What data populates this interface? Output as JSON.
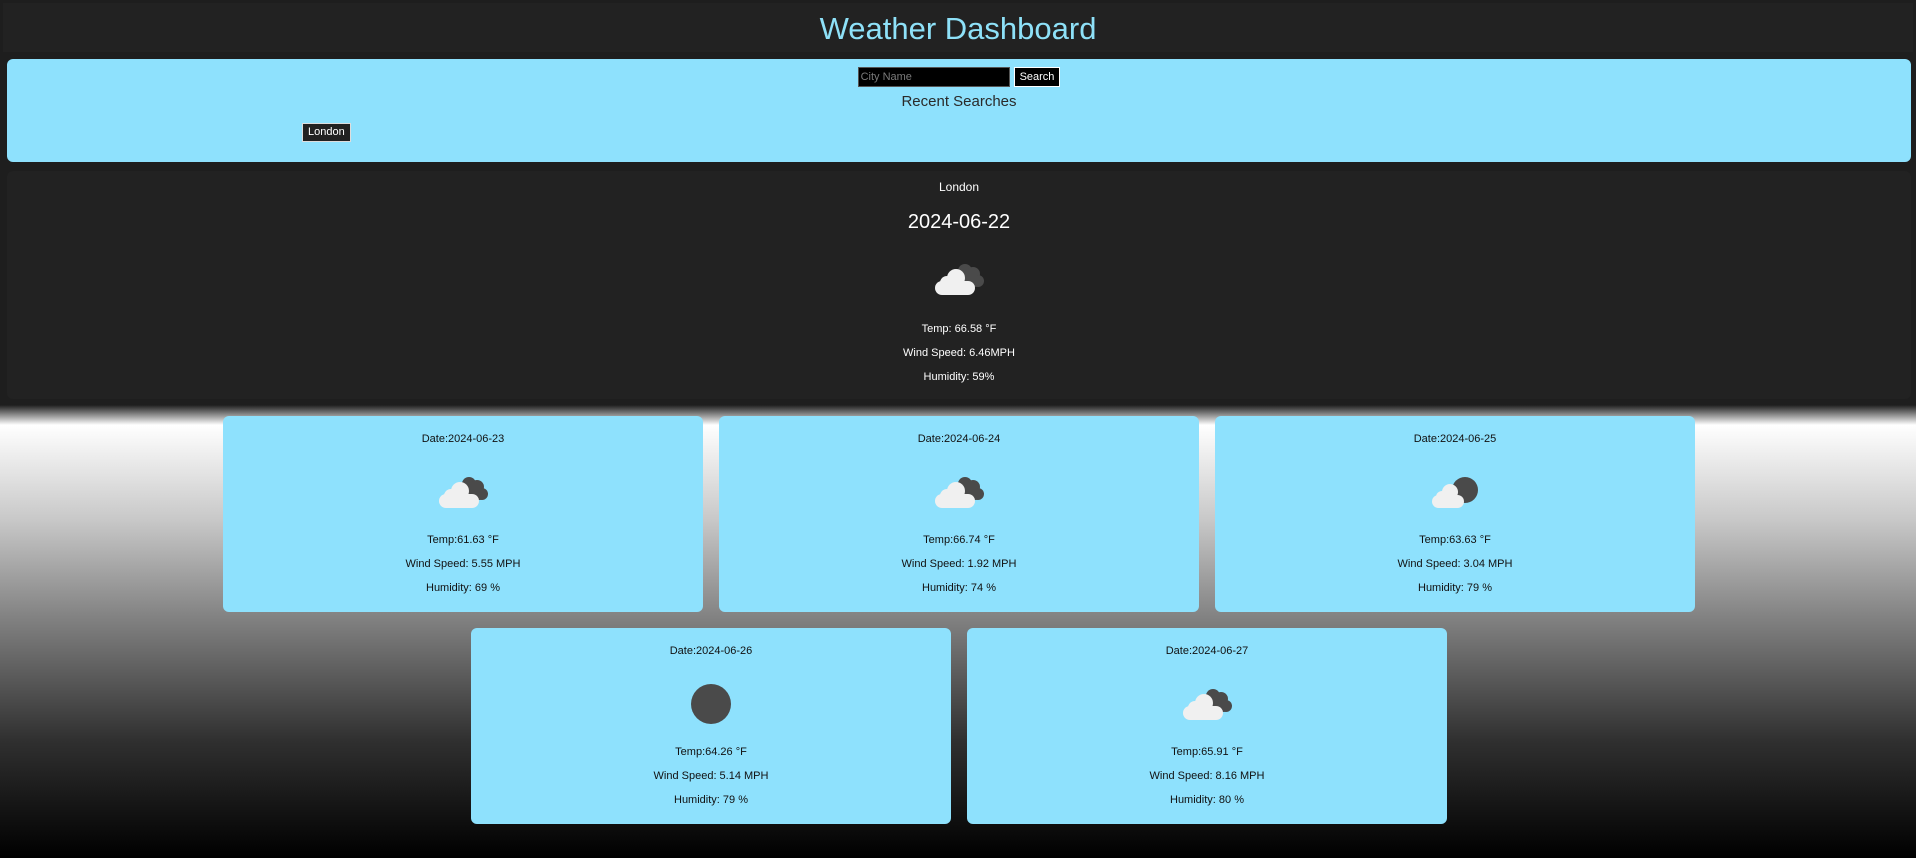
{
  "app": {
    "title": "Weather Dashboard"
  },
  "search": {
    "placeholder": "City Name",
    "value": "",
    "button_label": "Search",
    "recent_title": "Recent Searches",
    "recent": [
      "London"
    ]
  },
  "current": {
    "city": "London",
    "date": "2024-06-22",
    "icon": "broken-clouds-icon",
    "temp": "Temp: 66.58 °F",
    "wind": "Wind Speed: 6.46MPH",
    "humidity": "Humidity: 59%"
  },
  "forecast": [
    {
      "date": "Date:2024-06-23",
      "icon": "broken-clouds-icon",
      "temp": "Temp:61.63 °F",
      "wind": "Wind Speed: 5.55 MPH",
      "humidity": "Humidity: 69 %"
    },
    {
      "date": "Date:2024-06-24",
      "icon": "broken-clouds-icon",
      "temp": "Temp:66.74 °F",
      "wind": "Wind Speed: 1.92 MPH",
      "humidity": "Humidity: 74 %"
    },
    {
      "date": "Date:2024-06-25",
      "icon": "few-clouds-night-icon",
      "temp": "Temp:63.63 °F",
      "wind": "Wind Speed: 3.04 MPH",
      "humidity": "Humidity: 79 %"
    },
    {
      "date": "Date:2024-06-26",
      "icon": "clear-night-icon",
      "temp": "Temp:64.26 °F",
      "wind": "Wind Speed: 5.14 MPH",
      "humidity": "Humidity: 79 %"
    },
    {
      "date": "Date:2024-06-27",
      "icon": "broken-clouds-icon",
      "temp": "Temp:65.91 °F",
      "wind": "Wind Speed: 8.16 MPH",
      "humidity": "Humidity: 80 %"
    }
  ],
  "colors": {
    "accent_cyan": "#8ee1fd",
    "title_cyan": "#8ee1f8",
    "panel_dark": "#222222",
    "cloud_light": "#f0f0f0",
    "cloud_dark": "#4a4a4a"
  }
}
